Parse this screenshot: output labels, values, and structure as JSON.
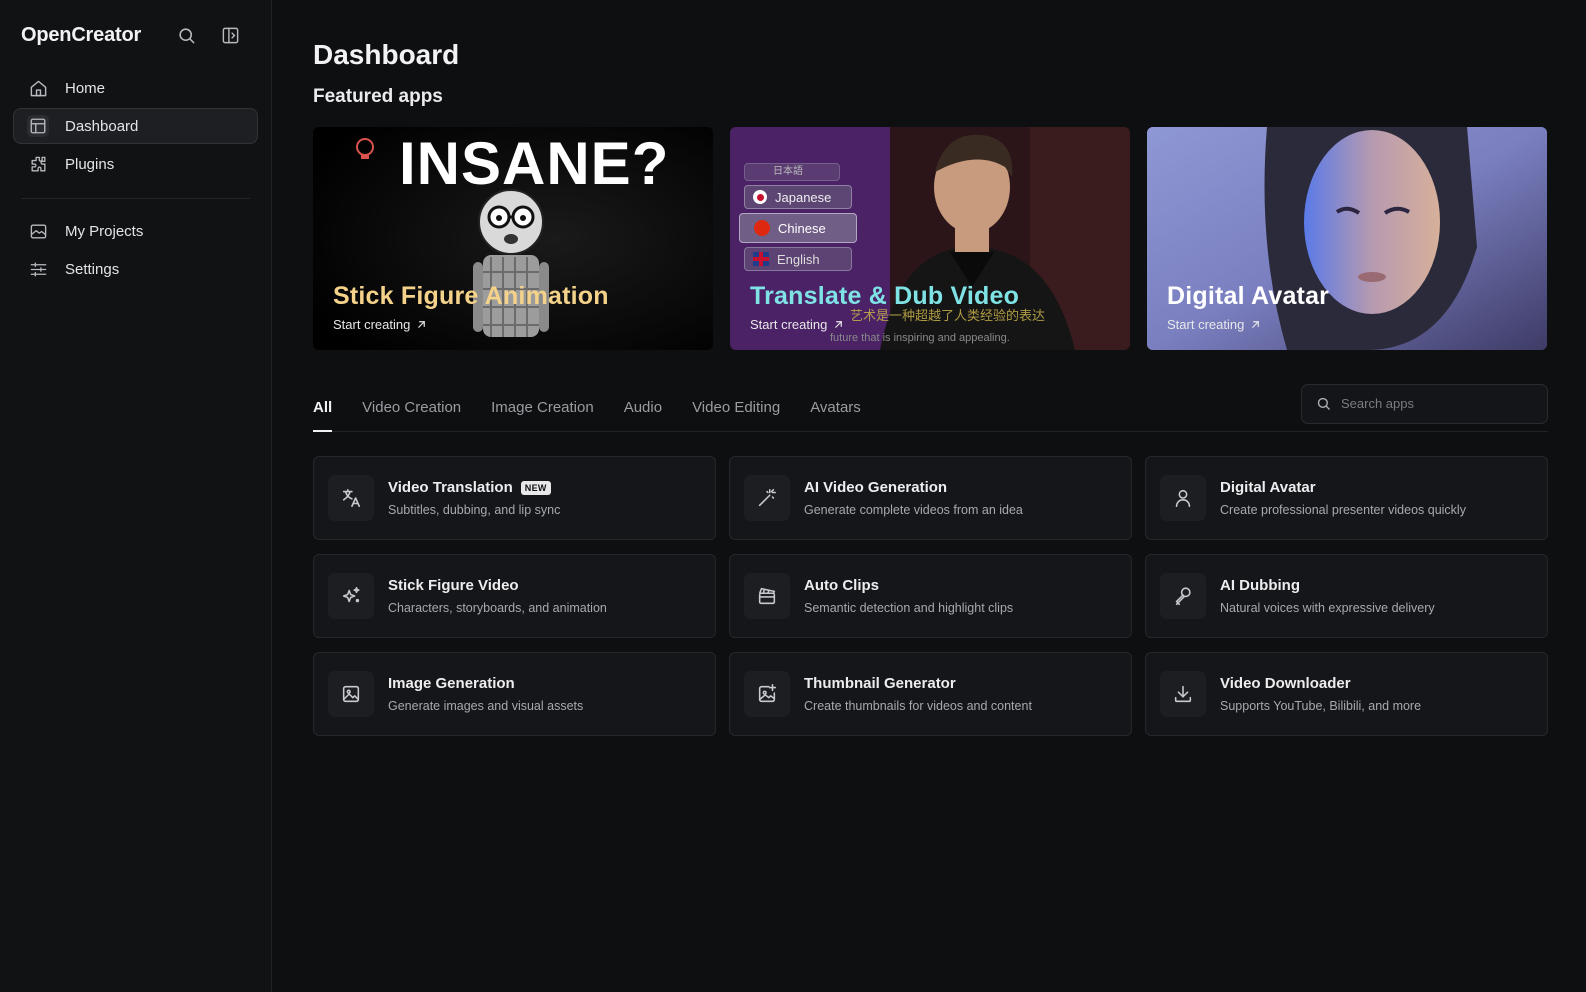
{
  "sidebar": {
    "brand": "OpenCreator",
    "nav": [
      {
        "label": "Home"
      },
      {
        "label": "Dashboard"
      },
      {
        "label": "Plugins"
      },
      {
        "label": "My Projects"
      },
      {
        "label": "Settings"
      }
    ]
  },
  "main": {
    "title": "Dashboard",
    "featured_title": "Featured apps",
    "featured": [
      {
        "title": "Stick Figure Animation",
        "cta": "Start creating",
        "color": "#f4d28a",
        "art_text": "INSANE?"
      },
      {
        "title": "Translate & Dub Video",
        "cta": "Start creating",
        "color": "#7fe3e6",
        "languages": [
          "日本語",
          "Japanese",
          "Chinese",
          "English"
        ],
        "subtitle_cn": "艺术是一种超越了人类经验的表达",
        "subtitle_en": "future that is inspiring and appealing."
      },
      {
        "title": "Digital Avatar",
        "cta": "Start creating",
        "color": "#ffffff"
      }
    ],
    "tabs": [
      {
        "label": "All"
      },
      {
        "label": "Video Creation"
      },
      {
        "label": "Image Creation"
      },
      {
        "label": "Audio"
      },
      {
        "label": "Video Editing"
      },
      {
        "label": "Avatars"
      }
    ],
    "search_placeholder": "Search apps",
    "apps": [
      {
        "title": "Video Translation",
        "badge": "NEW",
        "desc": "Subtitles, dubbing, and lip sync",
        "icon": "translate-icon"
      },
      {
        "title": "AI Video Generation",
        "desc": "Generate complete videos from an idea",
        "icon": "magic-wand-icon"
      },
      {
        "title": "Digital Avatar",
        "desc": "Create professional presenter videos quickly",
        "icon": "user-icon"
      },
      {
        "title": "Stick Figure Video",
        "desc": "Characters, storyboards, and animation",
        "icon": "sparkle-icon"
      },
      {
        "title": "Auto Clips",
        "desc": "Semantic detection and highlight clips",
        "icon": "clapperboard-icon"
      },
      {
        "title": "AI Dubbing",
        "desc": "Natural voices with expressive delivery",
        "icon": "microphone-icon"
      },
      {
        "title": "Image Generation",
        "desc": "Generate images and visual assets",
        "icon": "image-icon"
      },
      {
        "title": "Thumbnail Generator",
        "desc": "Create thumbnails for videos and content",
        "icon": "image-plus-icon"
      },
      {
        "title": "Video Downloader",
        "desc": "Supports YouTube, Bilibili, and more",
        "icon": "download-icon"
      }
    ]
  }
}
